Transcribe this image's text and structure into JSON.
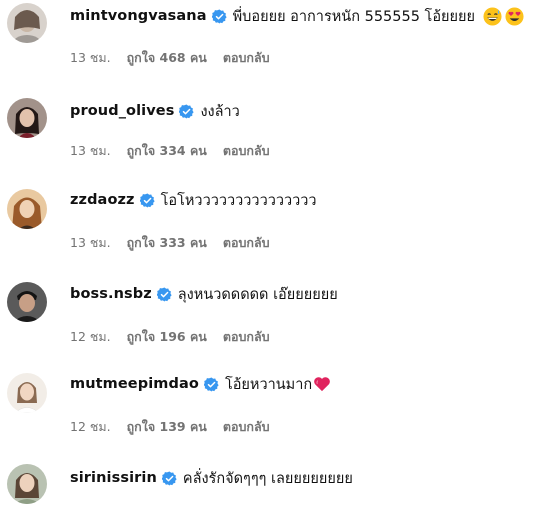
{
  "comments": [
    {
      "username": "mintvongvasana",
      "text": "พี่บอยยย อาการหนัก 555555 โอ้ยยยย",
      "emojis": [
        "grinning-sweat-emoji",
        "heart-eyes-emoji"
      ],
      "time": "13 ชม.",
      "likes": "ถูกใจ 468 คน",
      "reply": "ตอบกลับ",
      "avatar_color": "#cfc7c0"
    },
    {
      "username": "proud_olives",
      "text": "งงล้าว",
      "emojis": [],
      "time": "13 ชม.",
      "likes": "ถูกใจ 334 คน",
      "reply": "ตอบกลับ",
      "avatar_color": "#3a2a28"
    },
    {
      "username": "zzdaozz",
      "text": "โอโหววววววววววววววว",
      "emojis": [],
      "time": "13 ชม.",
      "likes": "ถูกใจ 333 คน",
      "reply": "ตอบกลับ",
      "avatar_color": "#d9a97b"
    },
    {
      "username": "boss.nsbz",
      "text": "ลุงหนวดดดดด เอ๊ยยยยยย",
      "emojis": [],
      "time": "12 ชม.",
      "likes": "ถูกใจ 196 คน",
      "reply": "ตอบกลับ",
      "avatar_color": "#2b2b2b"
    },
    {
      "username": "mutmeepimdao",
      "text": "โอ้ยหวานมาก",
      "emojis": [
        "red-heart-emoji"
      ],
      "time": "12 ชม.",
      "likes": "ถูกใจ 139 คน",
      "reply": "ตอบกลับ",
      "avatar_color": "#e8ddd2"
    },
    {
      "username": "sirinissirin",
      "text": "คลั่งรักจัดๆๆๆ เลยยยยยยยย",
      "emojis": [],
      "avatar_color": "#cdd3c4"
    }
  ],
  "colors": {
    "verified": "#3897f0",
    "meta_text": "#737373",
    "primary_text": "#111111",
    "heart": "#e0245e"
  }
}
